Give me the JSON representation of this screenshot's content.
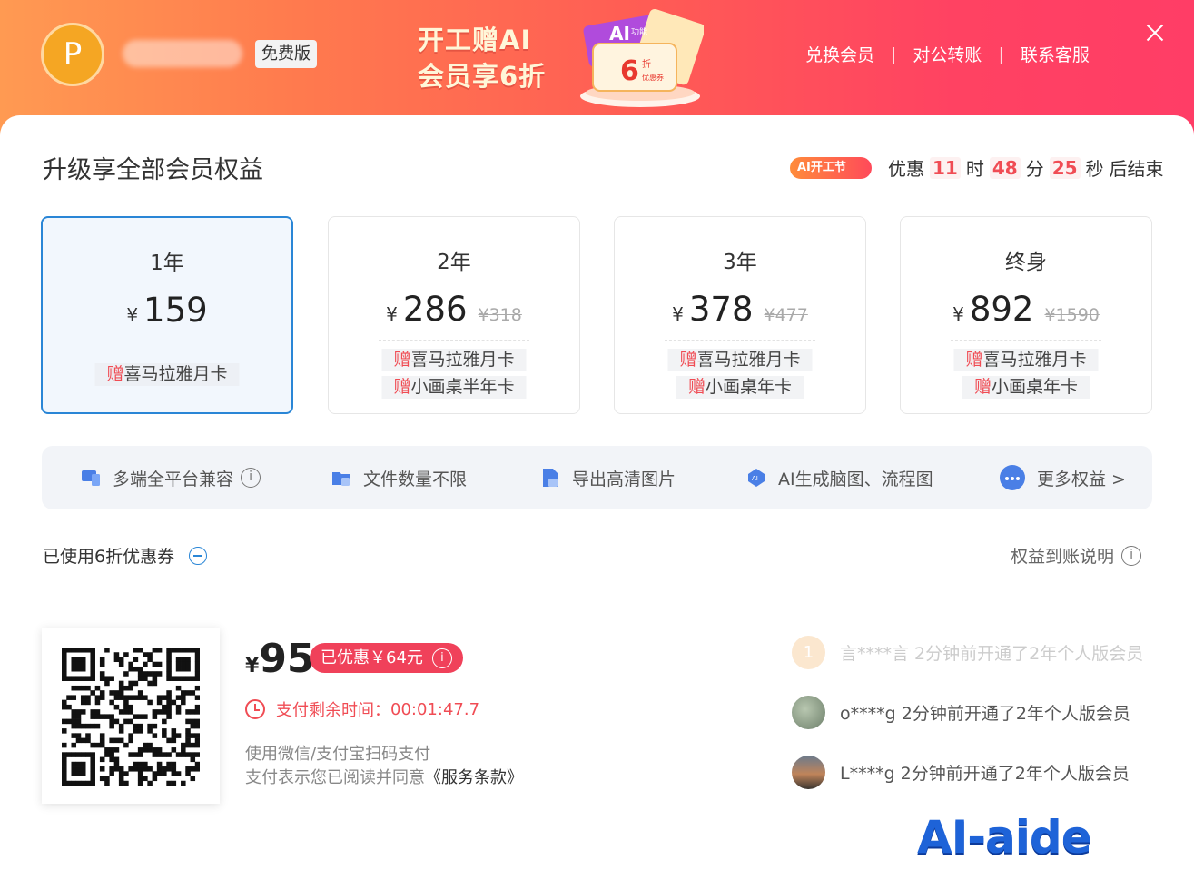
{
  "header": {
    "avatar_letter": "P",
    "plan_badge": "免费版",
    "promo_line1": "开工赠AI",
    "promo_line2": "会员享6折",
    "ticket": {
      "tag": "AI",
      "small": "功能",
      "discount_num": "6",
      "discount_unit": "折",
      "coupon_label": "优惠券"
    },
    "links": [
      "兑换会员",
      "对公转账",
      "联系客服"
    ],
    "close_icon": "close-icon"
  },
  "main": {
    "title": "升级享全部会员权益",
    "countdown": {
      "tag": "AI开工节",
      "prefix": "优惠",
      "hours": "11",
      "h_unit": "时",
      "minutes": "48",
      "m_unit": "分",
      "seconds": "25",
      "s_unit": "秒",
      "suffix": "后结束"
    }
  },
  "plans": [
    {
      "period": "1年",
      "currency": "¥",
      "price": "159",
      "original": "",
      "gifts": [
        {
          "mark": "赠",
          "text": "喜马拉雅月卡"
        }
      ]
    },
    {
      "period": "2年",
      "currency": "¥",
      "price": "286",
      "original": "¥318",
      "gifts": [
        {
          "mark": "赠",
          "text": "喜马拉雅月卡"
        },
        {
          "mark": "赠",
          "text": "小画桌半年卡"
        }
      ]
    },
    {
      "period": "3年",
      "currency": "¥",
      "price": "378",
      "original": "¥477",
      "gifts": [
        {
          "mark": "赠",
          "text": "喜马拉雅月卡"
        },
        {
          "mark": "赠",
          "text": "小画桌年卡"
        }
      ]
    },
    {
      "period": "终身",
      "currency": "¥",
      "price": "892",
      "original": "¥1590",
      "gifts": [
        {
          "mark": "赠",
          "text": "喜马拉雅月卡"
        },
        {
          "mark": "赠",
          "text": "小画桌年卡"
        }
      ]
    }
  ],
  "selected_plan": "1年",
  "benefits": [
    {
      "label": "多端全平台兼容",
      "icon": "devices-icon"
    },
    {
      "label": "文件数量不限",
      "icon": "folder-icon"
    },
    {
      "label": "导出高清图片",
      "icon": "image-file-icon"
    },
    {
      "label": "AI生成脑图、流程图",
      "icon": "ai-icon"
    },
    {
      "label": "更多权益 >",
      "icon": "more-icon"
    }
  ],
  "coupon": {
    "label": "已使用6折优惠券",
    "rights_label": "权益到账说明"
  },
  "payment": {
    "currency": "¥",
    "amount": "95",
    "discount_label": "已优惠￥64元",
    "timer_label": "支付剩余时间：",
    "timer_value": "00:01:47.7",
    "hint1": "使用微信/支付宝扫码支付",
    "hint2_prefix": "支付表示您已阅读并同意",
    "hint2_terms": "《服务条款》"
  },
  "feed": [
    {
      "text": "言****言 2分钟前开通了2年个人版会员",
      "avatar_letter": "1"
    },
    {
      "text": "o****g 2分钟前开通了2年个人版会员",
      "avatar_letter": ""
    },
    {
      "text": "L****g 2分钟前开通了2年个人版会员",
      "avatar_letter": ""
    }
  ],
  "watermark": "AI-aide",
  "colors": {
    "accent_blue": "#2a86d6",
    "accent_red": "#f04c54",
    "banner_start": "#ff9a52",
    "banner_end": "#ff3d66"
  }
}
